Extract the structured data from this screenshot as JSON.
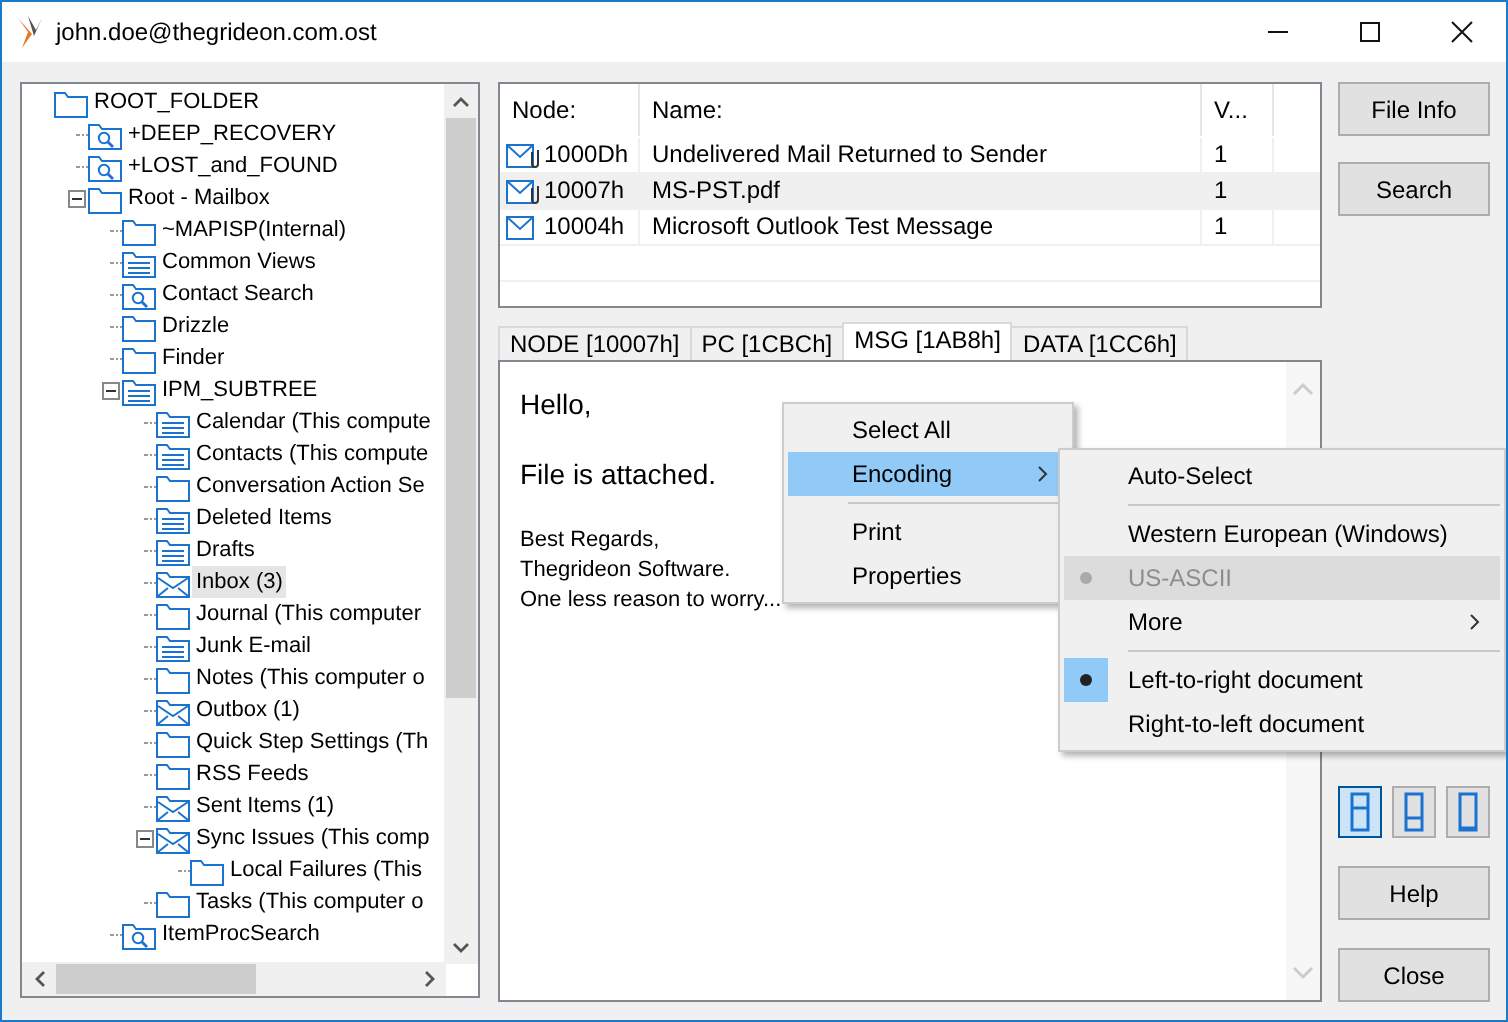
{
  "window": {
    "title": "john.doe@thegrideon.com.ost"
  },
  "tree": [
    {
      "label": "ROOT_FOLDER",
      "kind": "plain",
      "selected": false,
      "children": [
        {
          "label": "+DEEP_RECOVERY",
          "kind": "search",
          "selected": false
        },
        {
          "label": "+LOST_and_FOUND",
          "kind": "search",
          "selected": false
        },
        {
          "label": "Root - Mailbox",
          "kind": "plain",
          "selected": false,
          "expanded": true,
          "children": [
            {
              "label": "~MAPISP(Internal)",
              "kind": "plain",
              "selected": false
            },
            {
              "label": "Common Views",
              "kind": "list",
              "selected": false
            },
            {
              "label": "Contact Search",
              "kind": "search",
              "selected": false
            },
            {
              "label": "Drizzle",
              "kind": "plain",
              "selected": false
            },
            {
              "label": "Finder",
              "kind": "plain",
              "selected": false
            },
            {
              "label": "IPM_SUBTREE",
              "kind": "list",
              "selected": false,
              "expanded": true,
              "children": [
                {
                  "label": "Calendar (This compute",
                  "kind": "list",
                  "selected": false
                },
                {
                  "label": "Contacts (This compute",
                  "kind": "list",
                  "selected": false
                },
                {
                  "label": "Conversation Action Se",
                  "kind": "plain",
                  "selected": false
                },
                {
                  "label": "Deleted Items",
                  "kind": "list",
                  "selected": false
                },
                {
                  "label": "Drafts",
                  "kind": "list",
                  "selected": false
                },
                {
                  "label": "Inbox (3)",
                  "kind": "mail",
                  "selected": true
                },
                {
                  "label": "Journal (This computer",
                  "kind": "plain",
                  "selected": false
                },
                {
                  "label": "Junk E-mail",
                  "kind": "list",
                  "selected": false
                },
                {
                  "label": "Notes (This computer o",
                  "kind": "plain",
                  "selected": false
                },
                {
                  "label": "Outbox (1)",
                  "kind": "mail",
                  "selected": false
                },
                {
                  "label": "Quick Step Settings (Th",
                  "kind": "plain",
                  "selected": false
                },
                {
                  "label": "RSS Feeds",
                  "kind": "plain",
                  "selected": false
                },
                {
                  "label": "Sent Items (1)",
                  "kind": "mail",
                  "selected": false
                },
                {
                  "label": "Sync Issues (This comp",
                  "kind": "mail",
                  "selected": false,
                  "expanded": true,
                  "children": [
                    {
                      "label": "Local Failures (This",
                      "kind": "plain",
                      "selected": false
                    }
                  ]
                },
                {
                  "label": "Tasks (This computer o",
                  "kind": "plain",
                  "selected": false
                }
              ]
            },
            {
              "label": "ItemProcSearch",
              "kind": "search",
              "selected": false
            }
          ]
        }
      ]
    }
  ],
  "table": {
    "columns": [
      "Node:",
      "Name:",
      "V..."
    ],
    "rows": [
      {
        "kind": "attachment",
        "node": "1000Dh",
        "name": "Undelivered Mail Returned to Sender",
        "v": "1",
        "selected": false
      },
      {
        "kind": "attachment",
        "node": "10007h",
        "name": "MS-PST.pdf",
        "v": "1",
        "selected": true
      },
      {
        "kind": "mail",
        "node": "10004h",
        "name": "Microsoft Outlook Test Message",
        "v": "1",
        "selected": false
      }
    ]
  },
  "tabs": [
    {
      "label": "NODE [10007h]",
      "selected": false
    },
    {
      "label": "PC [1CBCh]",
      "selected": false
    },
    {
      "label": "MSG [1AB8h]",
      "selected": true
    },
    {
      "label": "DATA [1CC6h]",
      "selected": false
    }
  ],
  "message": {
    "greeting": "Hello,",
    "body": "File is attached.",
    "signature": [
      "Best Regards,",
      "Thegrideon Software.",
      "One less reason to worry..."
    ]
  },
  "context_menu": [
    {
      "label": "Select All",
      "selected": false,
      "submenu": false,
      "separator_before": false
    },
    {
      "label": "Encoding",
      "selected": true,
      "submenu": true,
      "separator_before": false
    },
    {
      "label": "Print",
      "selected": false,
      "submenu": false,
      "separator_before": true
    },
    {
      "label": "Properties",
      "selected": false,
      "submenu": false,
      "separator_before": false
    }
  ],
  "encoding_menu": [
    {
      "label": "Auto-Select",
      "checked": false,
      "disabled": false,
      "selected": false,
      "submenu": false,
      "separator_before": false
    },
    {
      "label": "Western European (Windows)",
      "checked": false,
      "disabled": false,
      "selected": false,
      "submenu": false,
      "separator_before": true
    },
    {
      "label": "US-ASCII",
      "checked": true,
      "disabled": true,
      "selected": true,
      "submenu": false,
      "separator_before": false
    },
    {
      "label": "More",
      "checked": false,
      "disabled": false,
      "selected": false,
      "submenu": true,
      "separator_before": false
    },
    {
      "label": "Left-to-right document",
      "checked": true,
      "disabled": false,
      "selected": false,
      "submenu": false,
      "separator_before": true
    },
    {
      "label": "Right-to-left document",
      "checked": false,
      "disabled": false,
      "selected": false,
      "submenu": false,
      "separator_before": false
    }
  ],
  "buttons_top": [
    "File Info",
    "Search"
  ],
  "layout_buttons": [
    {
      "kind": "top",
      "selected": true
    },
    {
      "kind": "middle",
      "selected": false
    },
    {
      "kind": "bottom",
      "selected": false
    }
  ],
  "buttons_bottom": [
    "Help",
    "Close"
  ]
}
